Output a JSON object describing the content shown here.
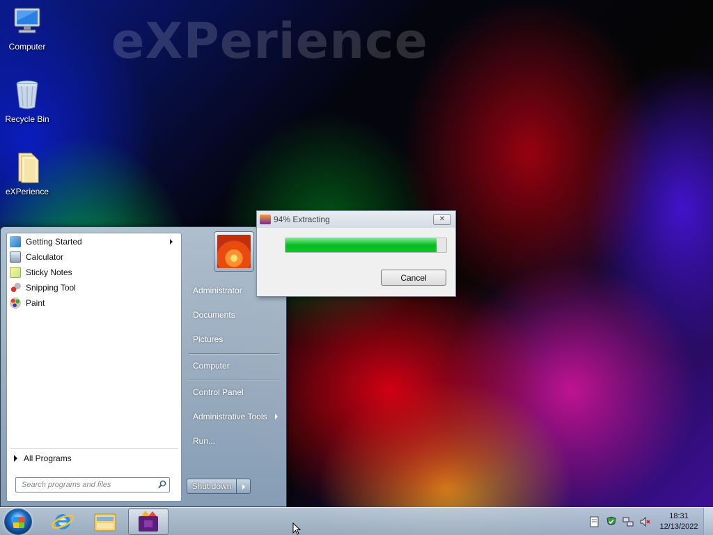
{
  "desktop": {
    "watermark": "eXPerience",
    "icons": [
      {
        "label": "Computer",
        "icon": "computer-icon"
      },
      {
        "label": "Recycle Bin",
        "icon": "recycle-bin-icon"
      },
      {
        "label": "eXPerience",
        "icon": "folder-icon"
      }
    ]
  },
  "start_menu": {
    "programs": [
      {
        "label": "Getting Started",
        "icon": "getting-started-icon",
        "has_submenu": true
      },
      {
        "label": "Calculator",
        "icon": "calculator-icon"
      },
      {
        "label": "Sticky Notes",
        "icon": "sticky-notes-icon"
      },
      {
        "label": "Snipping Tool",
        "icon": "snipping-tool-icon"
      },
      {
        "label": "Paint",
        "icon": "paint-icon"
      }
    ],
    "all_programs": "All Programs",
    "search_placeholder": "Search programs and files",
    "right_items": [
      {
        "label": "Administrator"
      },
      {
        "label": "Documents"
      },
      {
        "label": "Pictures"
      },
      {
        "label": "Computer"
      },
      {
        "label": "Control Panel"
      },
      {
        "label": "Administrative Tools",
        "has_submenu": true
      },
      {
        "label": "Run..."
      }
    ],
    "shutdown_label": "Shut down"
  },
  "dialog": {
    "title": "94% Extracting",
    "progress": 0.94,
    "cancel_label": "Cancel",
    "close_glyph": "✕"
  },
  "taskbar": {
    "pinned": [
      "internet-explorer-icon",
      "windows-explorer-icon",
      "archive-app-icon"
    ],
    "tray_icons": [
      "action-center-icon",
      "security-shield-icon",
      "network-icon",
      "volume-muted-icon"
    ],
    "time": "18:31",
    "date": "12/13/2022"
  },
  "colors": {
    "progress_fill": "#07b922",
    "start_menu_glass": "#b4c4d4"
  }
}
